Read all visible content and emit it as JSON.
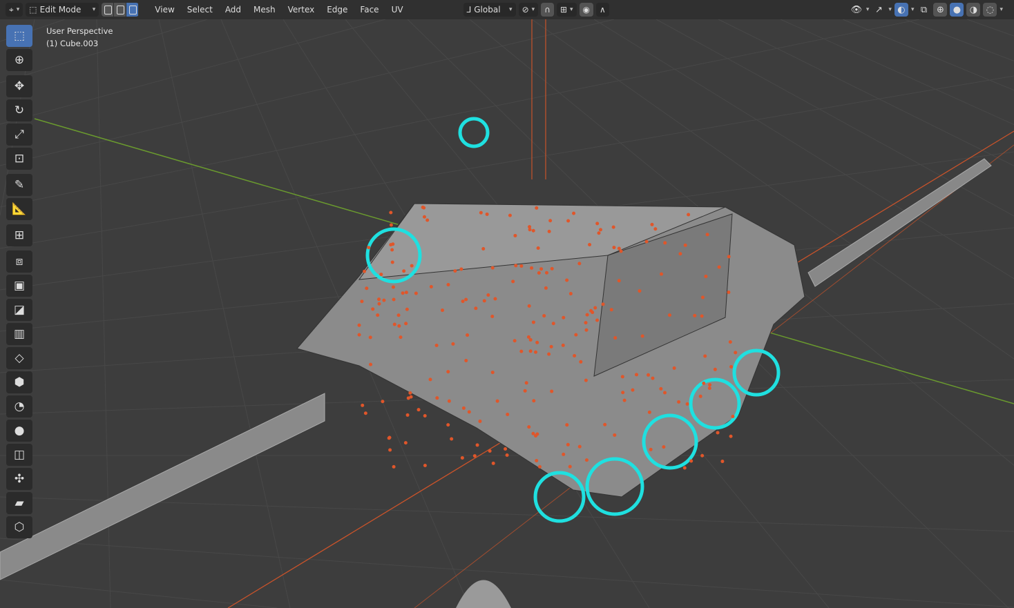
{
  "header": {
    "editor_type_icon": "view3d-icon",
    "mode": "Edit Mode",
    "select_modes": [
      "vertex",
      "edge",
      "face"
    ],
    "active_select_mode": "face",
    "menus": [
      "View",
      "Select",
      "Add",
      "Mesh",
      "Vertex",
      "Edge",
      "Face",
      "UV"
    ],
    "transform_orientation": "Global",
    "right_icons": [
      "visibility-icon",
      "gizmo-icon",
      "overlay-icon",
      "xray-icon",
      "wireframe-shading-icon",
      "solid-shading-icon",
      "material-shading-icon",
      "rendered-shading-icon"
    ]
  },
  "viewport": {
    "view_name": "User Perspective",
    "object_name": "(1) Cube.003"
  },
  "toolbar": [
    "select-box",
    "cursor",
    "move",
    "rotate",
    "scale",
    "transform",
    "annotate",
    "measure",
    "add-cube",
    "extrude",
    "inset",
    "bevel",
    "loop-cut",
    "knife",
    "poly-build",
    "spin",
    "smooth",
    "edge-slide",
    "shrink-fatten",
    "shear",
    "rip"
  ],
  "colors": {
    "accent": "#4772b3",
    "selected_edge": "#1fe0e0",
    "vertex": "#e0562a",
    "x_axis": "#c9532a",
    "y_axis": "#6a9a2e"
  }
}
